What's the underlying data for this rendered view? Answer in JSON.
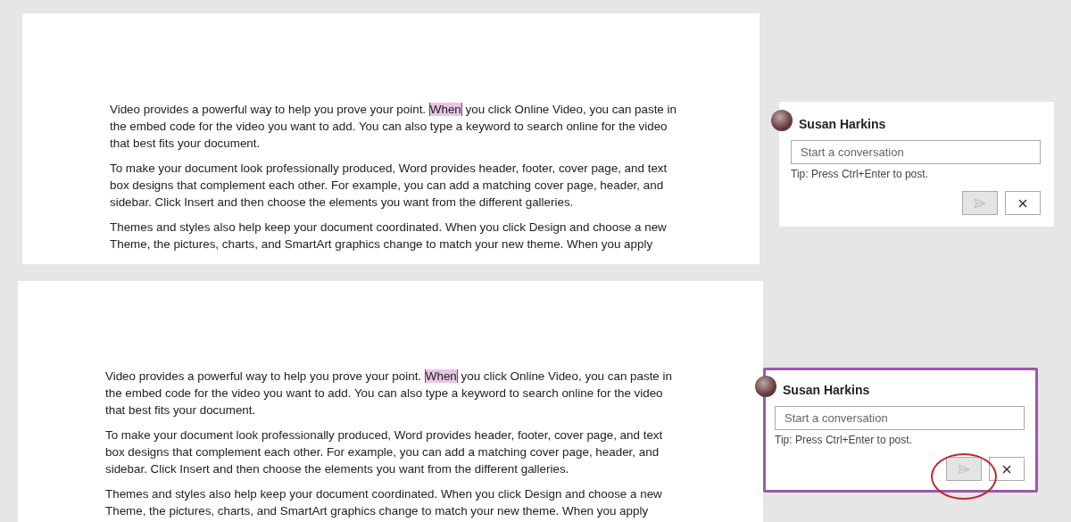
{
  "panels": [
    {
      "document": {
        "paragraphs": [
          {
            "text_before": "Video provides a powerful way to help you prove your point. ",
            "comment_anchor": "When",
            "text_after": " you click Online Video, you can paste in the embed code for the video you want to add. You can also type a keyword to search online for the video that best fits your document."
          },
          {
            "text": "To make your document look professionally produced, Word provides header, footer, cover page, and text box designs that complement each other. For example, you can add a matching cover page, header, and sidebar. Click Insert and then choose the elements you want from the different galleries."
          },
          {
            "text": "Themes and styles also help keep your document coordinated. When you click Design and choose a new Theme, the pictures, charts, and SmartArt graphics change to match your new theme. When you apply"
          }
        ]
      },
      "comment": {
        "author": "Susan Harkins",
        "placeholder": "Start a conversation",
        "tip": "Tip: Press Ctrl+Enter to post.",
        "focused": false,
        "post_button": {
          "disabled": true,
          "circled": false
        }
      }
    },
    {
      "document": {
        "paragraphs": [
          {
            "text_before": "Video provides a powerful way to help you prove your point. ",
            "comment_anchor": "When",
            "text_after": " you click Online Video, you can paste in the embed code for the video you want to add. You can also type a keyword to search online for the video that best fits your document."
          },
          {
            "text": "To make your document look professionally produced, Word provides header, footer, cover page, and text box designs that complement each other. For example, you can add a matching cover page, header, and sidebar. Click Insert and then choose the elements you want from the different galleries."
          },
          {
            "text": "Themes and styles also help keep your document coordinated. When you click Design and choose a new Theme, the pictures, charts, and SmartArt graphics change to match your new theme. When you apply"
          }
        ]
      },
      "comment": {
        "author": "Susan Harkins",
        "placeholder": "Start a conversation",
        "tip": "Tip: Press Ctrl+Enter to post.",
        "focused": true,
        "post_button": {
          "disabled": true,
          "circled": true
        }
      }
    }
  ]
}
